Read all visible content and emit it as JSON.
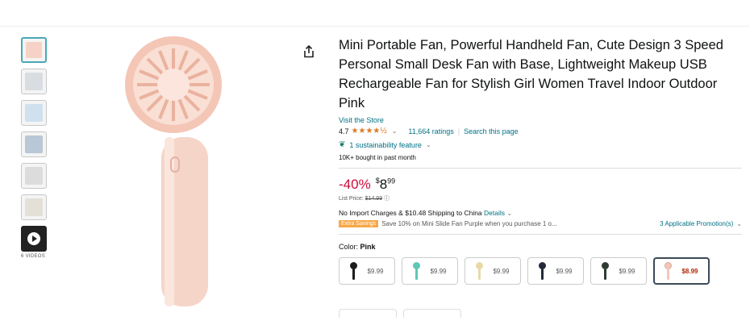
{
  "thumbnails": [
    {
      "name": "thumb-1",
      "active": true,
      "color": "#f6d2c6"
    },
    {
      "name": "thumb-2",
      "active": false,
      "color": "#d9dde2"
    },
    {
      "name": "thumb-3",
      "active": false,
      "color": "#cfe1ee"
    },
    {
      "name": "thumb-4",
      "active": false,
      "color": "#b9c7d6"
    },
    {
      "name": "thumb-5",
      "active": false,
      "color": "#dcdcdc"
    },
    {
      "name": "thumb-6",
      "active": false,
      "color": "#e4e0d8"
    }
  ],
  "videos_label": "6 VIDEOS",
  "product": {
    "title": "Mini Portable Fan, Powerful Handheld Fan, Cute Design 3 Speed Personal Small Desk Fan with Base, Lightweight Makeup USB Rechargeable Fan for Stylish Girl Women Travel Indoor Outdoor Pink",
    "visit_store": "Visit the Store",
    "rating": "4.7",
    "stars": "★★★★½",
    "ratings_count": "11,664 ratings",
    "search_page": "Search this page",
    "sustainability": "1 sustainability feature",
    "bought": "10K+ bought in past month"
  },
  "price": {
    "discount": "-40%",
    "symbol": "$",
    "whole": "8",
    "fraction": "99",
    "list_label": "List Price:",
    "list_value": "$14.99"
  },
  "shipping": {
    "text": "No Import Charges & $10.48 Shipping to China",
    "details": "Details"
  },
  "promo": {
    "badge": "Extra Savings",
    "text": "Save 10% on Mini Slide Fan Purple when you purchase 1 o...",
    "link": "3 Applicable Promotion(s)"
  },
  "color": {
    "label": "Color:",
    "value": "Pink"
  },
  "swatches": [
    {
      "price": "$9.99",
      "fan_color": "#1c1c1c",
      "selected": false
    },
    {
      "price": "$9.99",
      "fan_color": "#5ec6b5",
      "selected": false
    },
    {
      "price": "$9.99",
      "fan_color": "#e8d9a8",
      "selected": false
    },
    {
      "price": "$9.99",
      "fan_color": "#222a3a",
      "selected": false
    },
    {
      "price": "$9.99",
      "fan_color": "#2f3b33",
      "selected": false
    },
    {
      "price": "$8.99",
      "fan_color": "#f3c7b8",
      "selected": true
    }
  ],
  "colors": {
    "link": "#007185",
    "discount": "#cc0c39",
    "star": "#de7921",
    "badge": "#f7a847",
    "product_pink": "#f6cdbf"
  }
}
